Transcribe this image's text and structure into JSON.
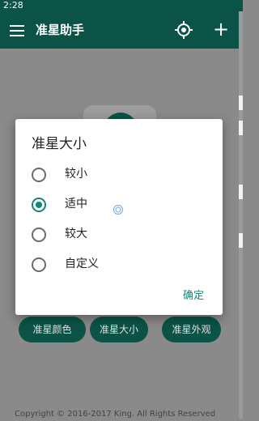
{
  "status_bar": {
    "time": "2:28"
  },
  "toolbar": {
    "title": "准星助手",
    "menu_icon": "hamburger-menu-icon",
    "target_icon": "crosshair-target-icon",
    "add_icon": "plus-icon"
  },
  "dialog": {
    "title": "准星大小",
    "options": [
      {
        "label": "较小",
        "checked": false
      },
      {
        "label": "适中",
        "checked": true
      },
      {
        "label": "较大",
        "checked": false
      },
      {
        "label": "自定义",
        "checked": false
      }
    ],
    "ok_label": "确定"
  },
  "bottom_buttons": [
    "准星颜色",
    "准星大小",
    "准星外观"
  ],
  "footer": {
    "copyright": "Copyright © 2016-2017 King. All Rights Reserved"
  },
  "colors": {
    "accent": "#0f8a78",
    "toolbar": "#0b5346",
    "scrim": "#8a8a8a"
  }
}
